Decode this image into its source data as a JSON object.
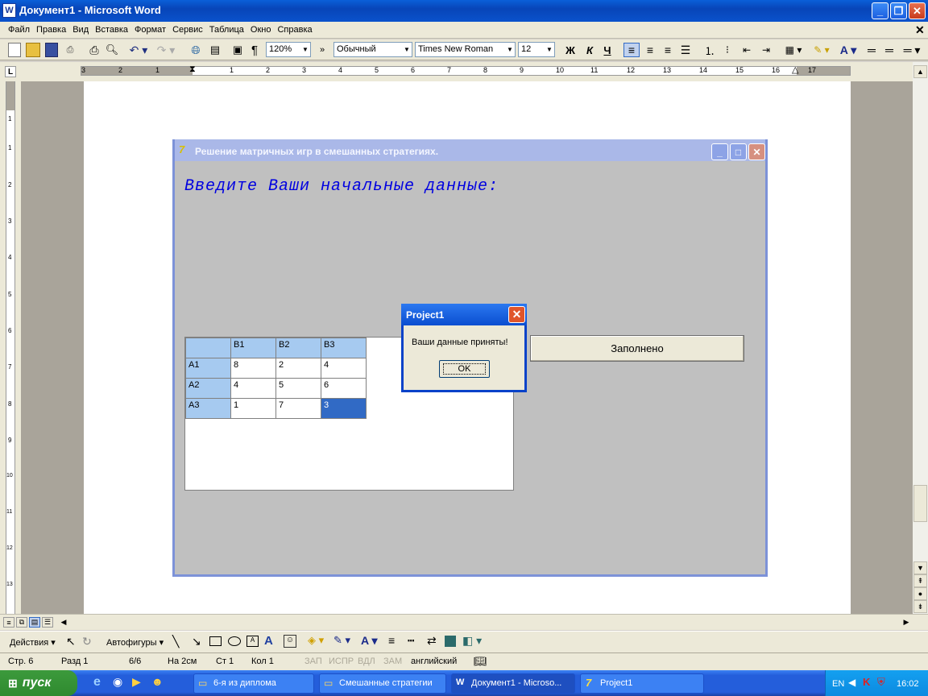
{
  "window": {
    "title": "Документ1 - Microsoft Word",
    "icon": "word-doc-icon"
  },
  "menu": [
    "Файл",
    "Правка",
    "Вид",
    "Вставка",
    "Формат",
    "Сервис",
    "Таблица",
    "Окно",
    "Справка"
  ],
  "toolbar": {
    "zoom": "120%",
    "style": "Обычный",
    "font": "Times New Roman",
    "size": "12",
    "bold": "Ж",
    "italic": "К",
    "underline": "Ч"
  },
  "ruler": {
    "numbers": [
      "3",
      "2",
      "1",
      "1",
      "2",
      "3",
      "4",
      "5",
      "6",
      "7",
      "8",
      "9",
      "10",
      "11",
      "12",
      "13",
      "14",
      "15",
      "16",
      "17"
    ]
  },
  "vruler": {
    "numbers": [
      "1",
      "1",
      "2",
      "3",
      "4",
      "5",
      "6",
      "7",
      "8",
      "9",
      "10",
      "11",
      "12",
      "13"
    ]
  },
  "app": {
    "title": "Решение матричных игр в смешанных стратегиях.",
    "heading": "Введите Ваши начальные данные:",
    "columns": [
      "B1",
      "B2",
      "B3"
    ],
    "rows": [
      {
        "label": "A1",
        "values": [
          "8",
          "2",
          "4"
        ]
      },
      {
        "label": "A2",
        "values": [
          "4",
          "5",
          "6"
        ]
      },
      {
        "label": "A3",
        "values": [
          "1",
          "7",
          "3"
        ]
      }
    ],
    "fill_button": "Заполнено"
  },
  "dialog": {
    "title": "Project1",
    "message": "Ваши данные приняты!",
    "ok": "OK"
  },
  "drawbar": {
    "actions": "Действия",
    "autoshapes": "Автофигуры"
  },
  "status": {
    "page": "Стр. 6",
    "section": "Разд 1",
    "pages": "6/6",
    "at": "На 2см",
    "line": "Ст 1",
    "col": "Кол 1",
    "rec": "ЗАП",
    "trk": "ИСПР",
    "ext": "ВДЛ",
    "ovr": "ЗАМ",
    "lang": "английский"
  },
  "taskbar": {
    "start": "пуск",
    "tasks": [
      "6-я из диплома",
      "Смешанные стратегии",
      "Документ1 - Microso...",
      "Project1"
    ],
    "lang": "EN",
    "clock": "16:02"
  }
}
